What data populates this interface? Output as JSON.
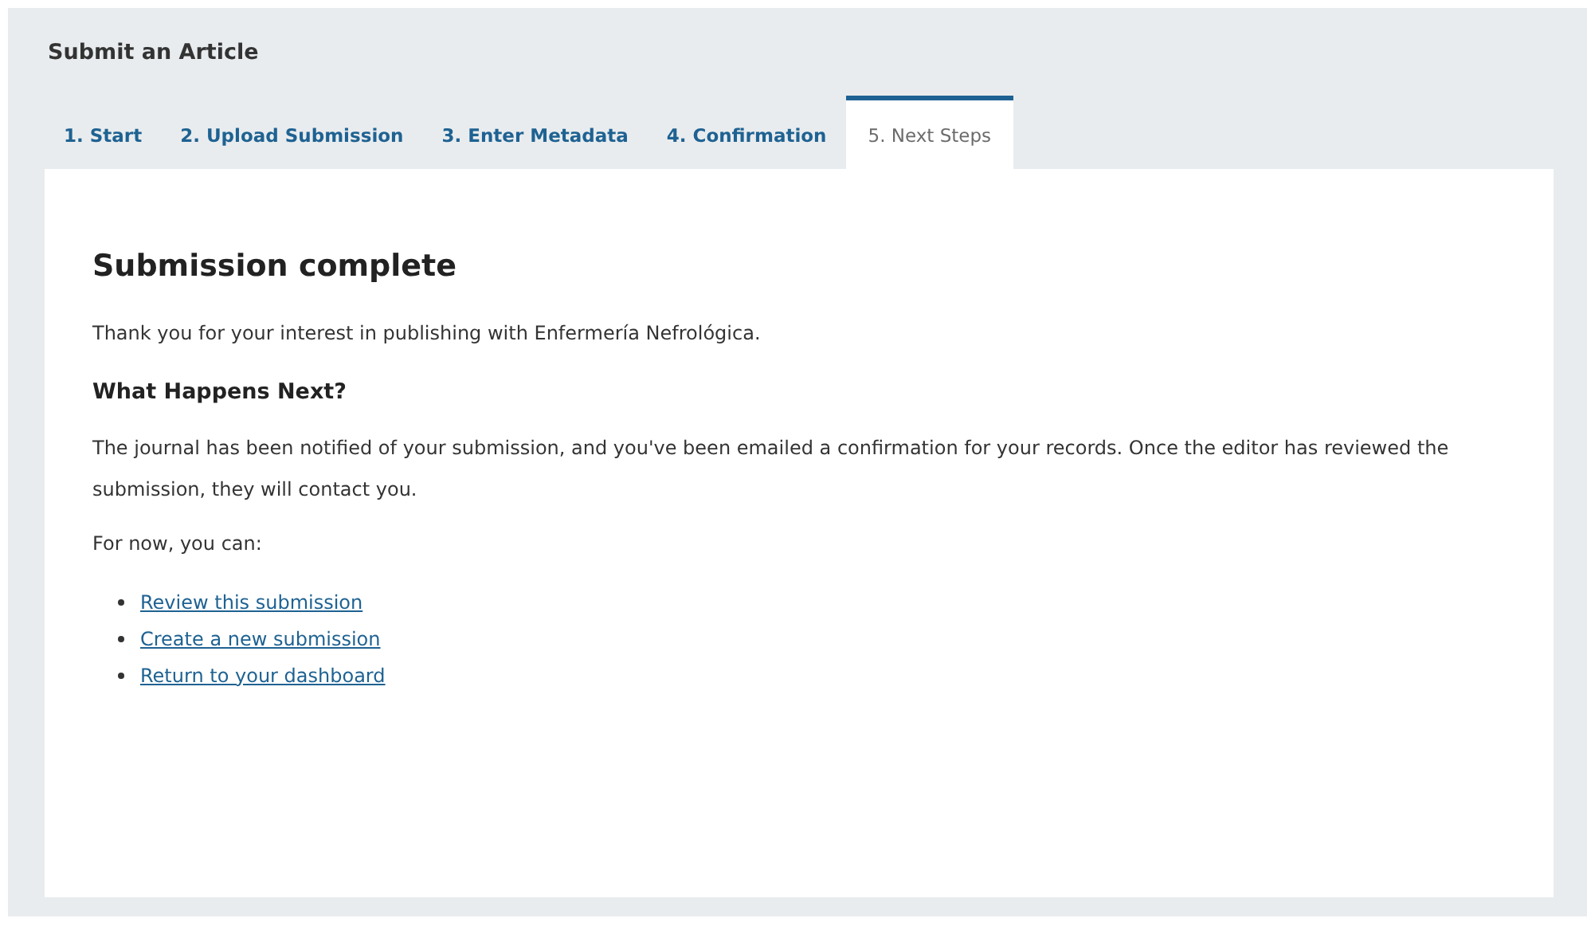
{
  "page": {
    "title": "Submit an Article"
  },
  "tabs": [
    {
      "label": "1. Start",
      "selected": false
    },
    {
      "label": "2. Upload Submission",
      "selected": false
    },
    {
      "label": "3. Enter Metadata",
      "selected": false
    },
    {
      "label": "4. Confirmation",
      "selected": false
    },
    {
      "label": "5. Next Steps",
      "selected": true
    }
  ],
  "content": {
    "heading": "Submission complete",
    "intro": "Thank you for your interest in publishing with Enfermería Nefrológica.",
    "subheading": "What Happens Next?",
    "paragraph": "The journal has been notified of your submission, and you've been emailed a confirmation for your records. Once the editor has reviewed the submission, they will contact you.",
    "prompt": "For now, you can:",
    "links": [
      {
        "label": "Review this submission"
      },
      {
        "label": "Create a new submission"
      },
      {
        "label": "Return to your dashboard"
      }
    ]
  }
}
